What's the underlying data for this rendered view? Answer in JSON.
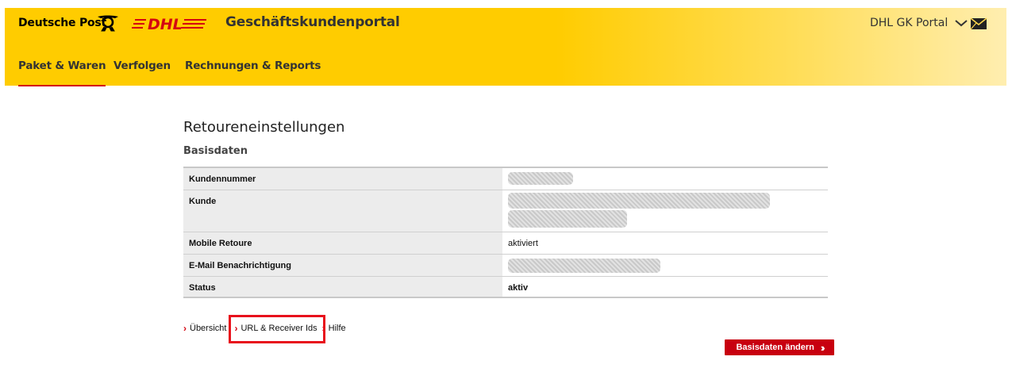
{
  "header": {
    "brand": "Deutsche Post",
    "dhl": "DHL",
    "portal_title": "Geschäftskundenportal",
    "portal_switch": "DHL GK Portal",
    "brand_color": "#ffcc00",
    "accent_color": "#d40511"
  },
  "nav": {
    "items": [
      {
        "label": "Paket & Waren",
        "active": true
      },
      {
        "label": "Verfolgen",
        "active": false
      },
      {
        "label": "Rechnungen & Reports",
        "active": false
      }
    ]
  },
  "main": {
    "title": "Retoureneinstellungen",
    "section": "Basisdaten",
    "rows": [
      {
        "label": "Kundennummer",
        "value": ""
      },
      {
        "label": "Kunde",
        "value": ""
      },
      {
        "label": "Mobile Retoure",
        "value": "aktiviert"
      },
      {
        "label": "E-Mail Benachrichtigung",
        "value": ""
      },
      {
        "label": "Status",
        "value": "aktiv"
      }
    ],
    "links": [
      "Übersicht",
      "URL & Receiver Ids",
      "Hilfe"
    ],
    "button": "Basisdaten ändern"
  }
}
